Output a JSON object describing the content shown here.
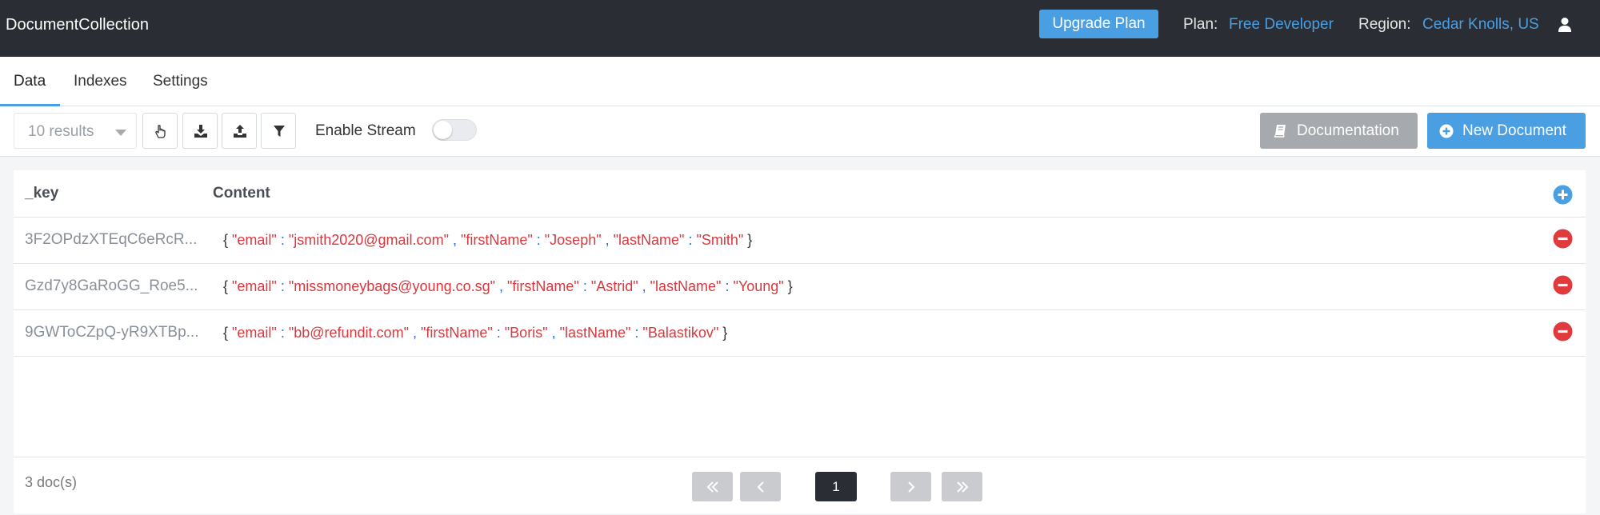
{
  "header": {
    "title": "DocumentCollection",
    "upgrade_label": "Upgrade Plan",
    "plan_label": "Plan:",
    "plan_value": "Free Developer",
    "region_label": "Region:",
    "region_value": "Cedar Knolls, US",
    "user_icon": "user-icon"
  },
  "tabs": [
    {
      "label": "Data",
      "active": true
    },
    {
      "label": "Indexes",
      "active": false
    },
    {
      "label": "Settings",
      "active": false
    }
  ],
  "toolbar": {
    "results_value": "10 results",
    "tool_icons": [
      "pointer-hand-icon",
      "download-icon",
      "upload-icon",
      "filter-icon"
    ],
    "stream_label": "Enable Stream",
    "stream_enabled": false,
    "documentation_label": "Documentation",
    "new_document_label": "New Document"
  },
  "table": {
    "columns": [
      "_key",
      "Content"
    ],
    "rows": [
      {
        "key": "3F2OPdzXTEqC6eRcR...",
        "email": "jsmith2020@gmail.com",
        "firstName": "Joseph",
        "lastName": "Smith"
      },
      {
        "key": "Gzd7y8GaRoGG_Roe5...",
        "email": "missmoneybags@young.co.sg",
        "firstName": "Astrid",
        "lastName": "Young"
      },
      {
        "key": "9GWToCZpQ-yR9XTBp...",
        "email": "bb@refundit.com",
        "firstName": "Boris",
        "lastName": "Balastikov"
      }
    ],
    "field_names": {
      "email": "\"email\"",
      "firstName": "\"firstName\"",
      "lastName": "\"lastName\""
    },
    "doc_count": "3 doc(s)",
    "current_page": "1"
  },
  "colors": {
    "accent": "#4a9fe3",
    "topbar": "#2a2d34",
    "json_string": "#d9383e",
    "remove": "#e03a3e"
  }
}
